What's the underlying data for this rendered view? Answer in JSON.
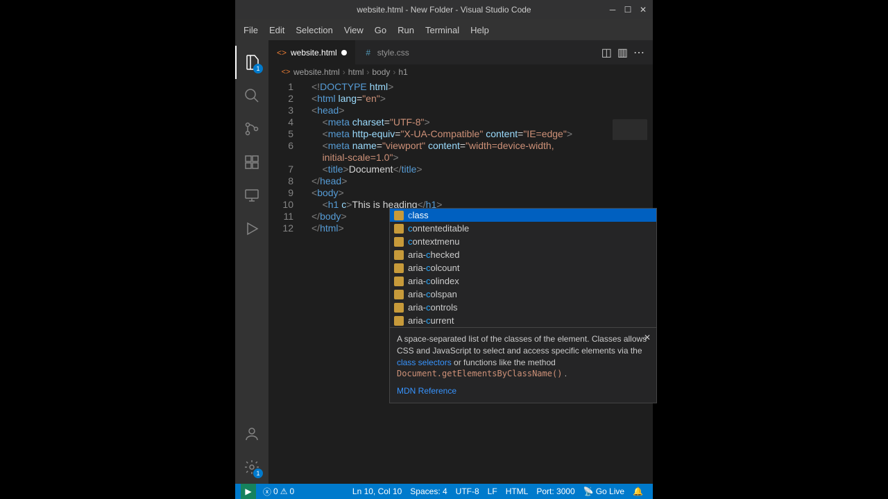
{
  "title": "website.html - New Folder - Visual Studio Code",
  "menubar": [
    "File",
    "Edit",
    "Selection",
    "View",
    "Go",
    "Run",
    "Terminal",
    "Help"
  ],
  "activity_badge": "1",
  "settings_badge": "1",
  "tabs": [
    {
      "label": "website.html",
      "active": true,
      "modified": true
    },
    {
      "label": "style.css",
      "active": false,
      "modified": false
    }
  ],
  "breadcrumbs": [
    "website.html",
    "html",
    "body",
    "h1"
  ],
  "line_numbers": [
    "1",
    "2",
    "3",
    "4",
    "5",
    "6",
    "7",
    "8",
    "9",
    "10",
    "11",
    "12"
  ],
  "code": {
    "l1": {
      "doctype": "<!DOCTYPE",
      "kw": "html",
      "close": ">"
    },
    "l2": {
      "open": "<html",
      "attr": "lang=",
      "val": "\"en\"",
      "close": ">"
    },
    "l3": "<head>",
    "l4": {
      "open": "<meta",
      "attr": "charset=",
      "val": "\"UTF-8\"",
      "close": ">"
    },
    "l5": {
      "open": "<meta",
      "a1": "http-equiv=",
      "v1": "\"X-UA-Compatible\"",
      "a2": "content=",
      "v2": "\"IE=edge\"",
      "close": ">"
    },
    "l6": {
      "open": "<meta",
      "a1": "name=",
      "v1": "\"viewport\"",
      "a2": "content=",
      "v2": "\"width=device-width,"
    },
    "l6b": "initial-scale=1.0\">",
    "l7": {
      "open": "<title>",
      "txt": "Document",
      "close": "</title>"
    },
    "l8": "</head>",
    "l9": "<body>",
    "l10": {
      "open": "<h1",
      "partial": "c",
      "txt": "This is heading",
      "close": "</h1>"
    },
    "l11": "</body>",
    "l12": "</html>"
  },
  "suggestions": {
    "items": [
      {
        "pre": "c",
        "rest": "lass",
        "sel": true
      },
      {
        "pre": "c",
        "rest": "ontenteditable"
      },
      {
        "pre": "c",
        "rest": "ontextmenu"
      },
      {
        "pre": "",
        "rest": "aria-",
        "mid": "c",
        "end": "hecked"
      },
      {
        "pre": "",
        "rest": "aria-",
        "mid": "c",
        "end": "olcount"
      },
      {
        "pre": "",
        "rest": "aria-",
        "mid": "c",
        "end": "olindex"
      },
      {
        "pre": "",
        "rest": "aria-",
        "mid": "c",
        "end": "olspan"
      },
      {
        "pre": "",
        "rest": "aria-",
        "mid": "c",
        "end": "ontrols"
      },
      {
        "pre": "",
        "rest": "aria-",
        "mid": "c",
        "end": "urrent"
      }
    ],
    "doc_text": "A space-separated list of the classes of the element. Classes allows CSS and JavaScript to select and access specific elements via the ",
    "doc_link1": "class selectors",
    "doc_text2": " or functions like the method ",
    "doc_code": "Document.getElementsByClassName()",
    "doc_text3": " .",
    "mdn": "MDN Reference"
  },
  "statusbar": {
    "errors": "0",
    "warnings": "0",
    "line_col": "Ln 10, Col 10",
    "spaces": "Spaces: 4",
    "encoding": "UTF-8",
    "eol": "LF",
    "lang": "HTML",
    "port": "Port: 3000",
    "golive": "Go Live"
  }
}
